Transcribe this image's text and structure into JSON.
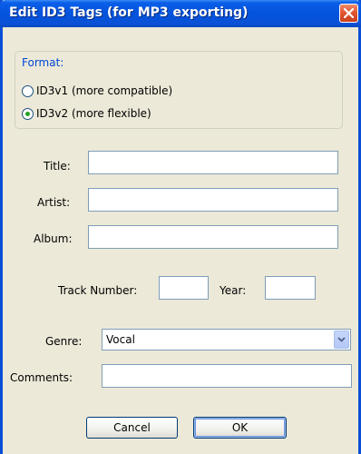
{
  "window": {
    "title": "Edit ID3 Tags (for MP3 exporting)"
  },
  "format": {
    "legend": "Format:",
    "options": [
      {
        "label": "ID3v1 (more compatible)",
        "checked": false
      },
      {
        "label": "ID3v2 (more flexible)",
        "checked": true
      }
    ]
  },
  "fields": {
    "title_label": "Title:",
    "title_value": "",
    "artist_label": "Artist:",
    "artist_value": "",
    "album_label": "Album:",
    "album_value": "",
    "track_label": "Track Number:",
    "track_value": "",
    "year_label": "Year:",
    "year_value": "",
    "genre_label": "Genre:",
    "genre_value": "Vocal",
    "comments_label": "Comments:",
    "comments_value": ""
  },
  "buttons": {
    "cancel": "Cancel",
    "ok": "OK"
  },
  "icons": {
    "close": "close-icon",
    "dropdown": "chevron-down-icon"
  },
  "colors": {
    "titlebar": "#0453dd",
    "close": "#e0542e",
    "legend": "#0046d5",
    "face": "#ece9d8"
  }
}
